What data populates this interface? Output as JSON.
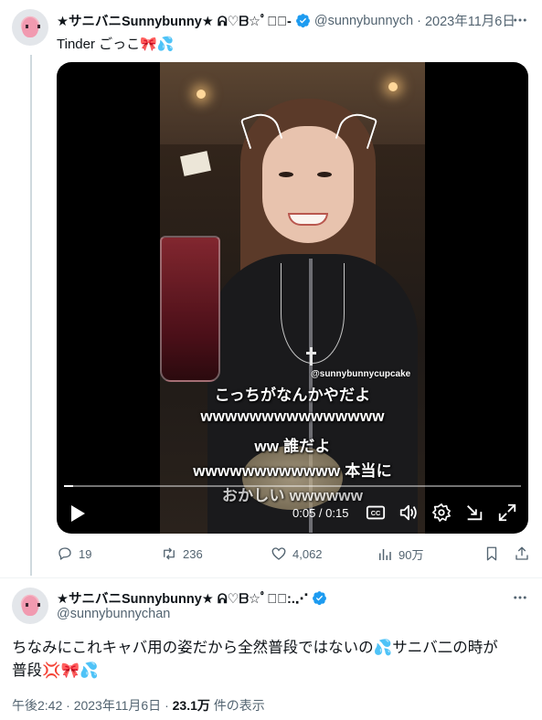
{
  "colors": {
    "text_primary": "#0f1419",
    "text_secondary": "#536471",
    "verified_blue": "#1d9bf0",
    "divider": "#eff3f4"
  },
  "tweet1": {
    "display_name": "★サニバニSunnybunny★ ᕱ♡ᗷ☆ﾟ∿ﾟ-",
    "verified_icon": "verified-badge-icon",
    "handle": "@sunnybunnych",
    "separator": "·",
    "date": "2023年11月6日",
    "more_icon": "more-icon",
    "text": "Tinder ごっこ",
    "emoji1": "🎀",
    "emoji2": "💦",
    "video": {
      "watermark": "@sunnybunnycupcake",
      "captions": [
        "こっちがなんかやだよ",
        "wwwwwwwwwwwwwww",
        "ww 誰だよ",
        "wwwwwwwwwwww 本当に",
        "おかしい wwwwww"
      ],
      "progress": 0.02,
      "time": "0:05 / 0:15",
      "controls": [
        "play-icon",
        "captions-icon",
        "volume-icon",
        "settings-icon",
        "exit-icon",
        "fullscreen-icon"
      ]
    },
    "actions": {
      "replies": "19",
      "reposts": "236",
      "likes": "4,062",
      "views": "90万"
    }
  },
  "tweet2": {
    "display_name": "★サニバニSunnybunny★ ᕱ♡ᗷ☆ﾟ∿ﾟ:.⋰",
    "verified_icon": "verified-badge-icon",
    "handle": "@sunnybunnychan",
    "more_icon": "more-icon",
    "text_line1": "ちなみにこれキャバ用の姿だから全然普段ではないの",
    "text_line1_tail": "サニバ二の時が",
    "text_line2": "普段",
    "emoji_sweat": "💦",
    "emoji_anger": "💢",
    "emoji_bow": "🎀",
    "time": "午後2:42",
    "separator": "·",
    "date": "2023年11月6日",
    "views_count": "23.1万",
    "views_label": "件の表示"
  }
}
